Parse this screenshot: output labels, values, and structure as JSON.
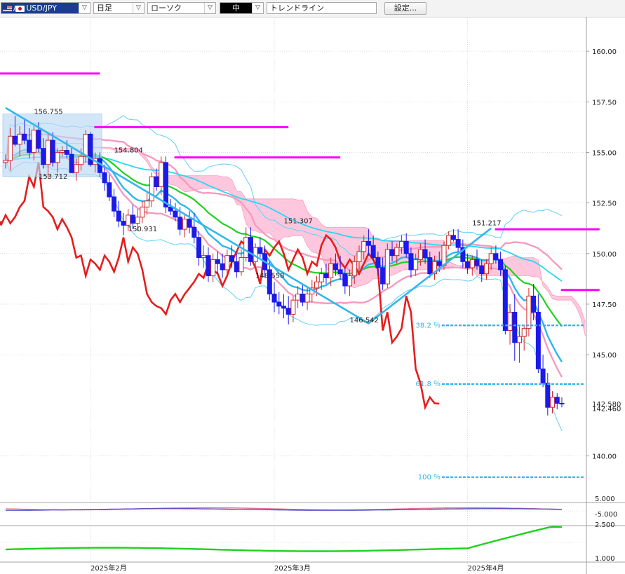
{
  "toolbar": {
    "currency_pair": "USD/JPY",
    "timeframe": "日足",
    "chart_style": "ローソク",
    "size": "中",
    "tool": "トレンドライン",
    "settings_button": "設定..."
  },
  "chart_data": [
    {
      "type": "line",
      "panel": "main",
      "ylim": [
        137.8,
        161.7
      ],
      "y_ticks": [
        "160.00",
        "157.50",
        "155.00",
        "152.50",
        "150.00",
        "147.50",
        "145.00",
        "140.00"
      ],
      "current_price_labels": [
        "142.580",
        "142.460"
      ],
      "x_ticks": [
        "2025年2月",
        "2025年3月",
        "2025年4月"
      ],
      "annotations": [
        {
          "text": "156.755",
          "x": 6,
          "y": 156.8
        },
        {
          "text": "153.712",
          "x": 7,
          "y": 153.6
        },
        {
          "text": "154.804",
          "x": 23,
          "y": 154.9
        },
        {
          "text": "150.931",
          "x": 26,
          "y": 151.0
        },
        {
          "text": "151.307",
          "x": 59,
          "y": 151.4
        },
        {
          "text": "148.558",
          "x": 53,
          "y": 148.7
        },
        {
          "text": "146.542",
          "x": 73,
          "y": 146.5
        },
        {
          "text": "151.217",
          "x": 99,
          "y": 151.3
        }
      ],
      "fibonacci": [
        {
          "label": "38.2 ％",
          "value": 146.45
        },
        {
          "label": "61.8 ％",
          "value": 143.55
        },
        {
          "label": "100 ％",
          "value": 138.95
        }
      ],
      "resistance_lines": [
        {
          "x0": 0,
          "x1": 20,
          "value": 158.9
        },
        {
          "x0": 20,
          "x1": 60,
          "value": 156.25
        },
        {
          "x0": 37,
          "x1": 71,
          "value": 154.75
        },
        {
          "x0": 105,
          "x1": 126,
          "value": 151.2
        },
        {
          "x0": 119,
          "x1": 126,
          "value": 148.2
        }
      ],
      "trendlines": [
        {
          "points": [
            [
              0,
              157.2
            ],
            [
              77,
              146.55
            ],
            [
              103,
              151.25
            ]
          ]
        }
      ],
      "candles": [
        [
          0,
          154.5,
          154.9,
          154.2,
          154.6
        ],
        [
          1,
          154.6,
          156.2,
          154.1,
          155.8
        ],
        [
          2,
          155.8,
          156.8,
          155.3,
          155.4
        ],
        [
          3,
          155.4,
          156.3,
          154.8,
          155.9
        ],
        [
          4,
          155.9,
          156.7,
          155.4,
          155.6
        ],
        [
          5,
          155.6,
          156.2,
          154.7,
          155.0
        ],
        [
          6,
          155.0,
          156.3,
          154.6,
          156.1
        ],
        [
          7,
          156.1,
          156.5,
          155.0,
          155.2
        ],
        [
          8,
          155.2,
          155.7,
          154.2,
          154.4
        ],
        [
          9,
          154.4,
          156.0,
          153.7,
          155.6
        ],
        [
          10,
          155.6,
          156.0,
          154.3,
          154.5
        ],
        [
          11,
          154.5,
          155.2,
          154.0,
          155.0
        ],
        [
          12,
          155.0,
          155.3,
          154.8,
          155.1
        ],
        [
          13,
          155.1,
          155.6,
          154.7,
          154.9
        ],
        [
          14,
          154.9,
          155.3,
          154.0,
          154.0
        ],
        [
          15,
          154.0,
          154.7,
          153.6,
          154.4
        ],
        [
          16,
          154.4,
          155.2,
          154.1,
          154.8
        ],
        [
          17,
          154.8,
          156.1,
          154.5,
          155.9
        ],
        [
          18,
          155.9,
          156.0,
          154.3,
          154.4
        ],
        [
          19,
          154.4,
          155.0,
          154.0,
          154.7
        ],
        [
          20,
          154.7,
          155.0,
          153.8,
          154.0
        ],
        [
          21,
          154.0,
          154.4,
          153.1,
          153.5
        ],
        [
          22,
          153.5,
          153.9,
          152.6,
          152.8
        ],
        [
          23,
          152.8,
          153.2,
          151.8,
          152.1
        ],
        [
          24,
          152.1,
          152.6,
          151.3,
          151.6
        ],
        [
          25,
          151.6,
          152.0,
          150.9,
          151.4
        ],
        [
          26,
          151.4,
          152.2,
          151.1,
          151.9
        ],
        [
          27,
          151.9,
          152.4,
          151.2,
          151.5
        ],
        [
          28,
          151.5,
          152.2,
          151.1,
          151.8
        ],
        [
          29,
          151.8,
          152.6,
          151.5,
          152.3
        ],
        [
          30,
          152.3,
          153.0,
          151.9,
          152.6
        ],
        [
          31,
          152.6,
          154.0,
          152.3,
          153.8
        ],
        [
          32,
          153.8,
          154.2,
          153.1,
          153.3
        ],
        [
          33,
          153.3,
          154.8,
          152.9,
          154.5
        ],
        [
          34,
          154.5,
          154.8,
          152.0,
          152.3
        ],
        [
          35,
          152.3,
          152.7,
          151.9,
          152.1
        ],
        [
          36,
          152.1,
          152.5,
          151.6,
          151.8
        ],
        [
          37,
          151.8,
          152.3,
          150.9,
          151.2
        ],
        [
          38,
          151.2,
          151.9,
          150.8,
          151.7
        ],
        [
          39,
          151.7,
          152.1,
          151.0,
          151.3
        ],
        [
          40,
          151.3,
          152.0,
          150.5,
          150.8
        ],
        [
          41,
          150.8,
          151.1,
          149.4,
          149.8
        ],
        [
          42,
          149.8,
          150.4,
          149.3,
          149.9
        ],
        [
          43,
          149.9,
          150.3,
          148.6,
          148.9
        ],
        [
          44,
          148.9,
          150.0,
          148.6,
          149.7
        ],
        [
          45,
          149.7,
          150.1,
          149.0,
          149.5
        ],
        [
          46,
          149.5,
          150.0,
          148.8,
          149.2
        ],
        [
          47,
          149.2,
          150.2,
          148.9,
          149.9
        ],
        [
          48,
          149.9,
          150.4,
          149.3,
          149.6
        ],
        [
          49,
          149.6,
          150.0,
          148.8,
          149.1
        ],
        [
          50,
          149.1,
          150.2,
          148.9,
          149.8
        ],
        [
          51,
          149.8,
          151.3,
          149.6,
          150.8
        ],
        [
          52,
          150.8,
          151.3,
          149.4,
          149.6
        ],
        [
          53,
          149.6,
          150.5,
          149.3,
          150.3
        ],
        [
          54,
          150.3,
          150.8,
          149.8,
          150.0
        ],
        [
          55,
          150.0,
          150.4,
          148.8,
          149.2
        ],
        [
          56,
          149.2,
          149.6,
          147.7,
          148.0
        ],
        [
          57,
          148.0,
          148.6,
          147.1,
          147.6
        ],
        [
          58,
          147.6,
          148.1,
          147.0,
          147.4
        ],
        [
          59,
          147.4,
          148.0,
          146.8,
          147.3
        ],
        [
          60,
          147.3,
          147.9,
          146.5,
          147.0
        ],
        [
          61,
          147.0,
          147.9,
          146.6,
          147.7
        ],
        [
          62,
          147.7,
          148.4,
          147.3,
          148.0
        ],
        [
          63,
          148.0,
          148.5,
          147.4,
          147.6
        ],
        [
          64,
          147.6,
          148.3,
          147.2,
          148.0
        ],
        [
          65,
          148.0,
          148.7,
          147.6,
          148.3
        ],
        [
          66,
          148.3,
          148.9,
          147.9,
          148.6
        ],
        [
          67,
          148.6,
          149.3,
          148.2,
          149.0
        ],
        [
          68,
          149.0,
          149.5,
          148.5,
          148.8
        ],
        [
          69,
          148.8,
          149.8,
          148.4,
          149.5
        ],
        [
          70,
          149.5,
          150.0,
          148.9,
          149.2
        ],
        [
          71,
          149.2,
          149.9,
          148.7,
          149.0
        ],
        [
          72,
          149.0,
          149.3,
          148.0,
          148.4
        ],
        [
          73,
          148.4,
          149.2,
          147.9,
          148.9
        ],
        [
          74,
          148.9,
          149.9,
          148.5,
          149.6
        ],
        [
          75,
          149.6,
          150.4,
          149.2,
          150.1
        ],
        [
          76,
          150.1,
          150.9,
          149.7,
          150.6
        ],
        [
          77,
          150.6,
          151.2,
          149.9,
          150.4
        ],
        [
          78,
          150.4,
          150.9,
          149.6,
          149.8
        ],
        [
          79,
          149.8,
          150.1,
          148.9,
          149.3
        ],
        [
          80,
          149.3,
          149.8,
          148.2,
          148.5
        ],
        [
          81,
          148.5,
          150.5,
          148.3,
          150.2
        ],
        [
          82,
          150.2,
          150.6,
          149.6,
          149.9
        ],
        [
          83,
          149.9,
          150.5,
          149.5,
          150.3
        ],
        [
          84,
          150.3,
          150.9,
          150.0,
          150.6
        ],
        [
          85,
          150.6,
          151.0,
          149.8,
          150.0
        ],
        [
          86,
          150.0,
          150.3,
          148.8,
          149.2
        ],
        [
          87,
          149.2,
          150.0,
          148.9,
          149.7
        ],
        [
          88,
          149.7,
          150.5,
          149.4,
          150.2
        ],
        [
          89,
          150.2,
          150.7,
          149.5,
          149.8
        ],
        [
          90,
          149.8,
          150.1,
          148.8,
          149.0
        ],
        [
          91,
          149.0,
          149.9,
          148.7,
          149.6
        ],
        [
          92,
          149.6,
          150.1,
          149.1,
          149.4
        ],
        [
          93,
          149.4,
          150.6,
          149.2,
          150.4
        ],
        [
          94,
          150.4,
          151.1,
          150.2,
          150.9
        ],
        [
          95,
          150.9,
          151.2,
          150.6,
          150.7
        ],
        [
          96,
          150.7,
          151.2,
          150.1,
          150.3
        ],
        [
          97,
          150.3,
          150.7,
          149.3,
          149.6
        ],
        [
          98,
          149.6,
          150.0,
          149.0,
          149.3
        ],
        [
          99,
          149.3,
          149.9,
          148.9,
          149.7
        ],
        [
          100,
          149.7,
          150.2,
          149.2,
          149.4
        ],
        [
          101,
          149.4,
          149.7,
          148.6,
          149.0
        ],
        [
          102,
          149.0,
          149.7,
          148.7,
          149.5
        ],
        [
          103,
          149.5,
          150.3,
          149.2,
          150.0
        ],
        [
          104,
          150.0,
          150.4,
          149.5,
          149.7
        ],
        [
          105,
          149.7,
          150.1,
          148.9,
          149.2
        ],
        [
          106,
          149.2,
          149.4,
          146.0,
          146.2
        ],
        [
          107,
          146.2,
          147.5,
          145.5,
          147.1
        ],
        [
          108,
          147.1,
          148.0,
          144.7,
          145.6
        ],
        [
          109,
          145.6,
          146.4,
          144.6,
          145.9
        ],
        [
          110,
          145.9,
          146.4,
          145.2,
          146.3
        ],
        [
          111,
          146.3,
          148.3,
          145.9,
          147.9
        ],
        [
          112,
          147.9,
          148.5,
          146.7,
          147.1
        ],
        [
          113,
          147.1,
          148.0,
          144.1,
          144.3
        ],
        [
          114,
          144.3,
          145.0,
          143.4,
          143.6
        ],
        [
          115,
          143.6,
          144.1,
          142.0,
          142.4
        ],
        [
          116,
          142.4,
          143.2,
          142.1,
          142.9
        ],
        [
          117,
          142.9,
          143.1,
          142.3,
          142.6
        ],
        [
          118,
          142.6,
          142.9,
          142.4,
          142.58
        ]
      ]
    },
    {
      "type": "line",
      "panel": "sub1",
      "y_ticks": [
        "5.000",
        "-5.000"
      ]
    },
    {
      "type": "line",
      "panel": "sub2",
      "y_ticks": [
        "2.500",
        "1.000"
      ]
    }
  ],
  "colors": {
    "bull": "#d22828",
    "bear": "#1a1aeb",
    "cloud": "#ffb4d2",
    "kumo_box": "#bcd8f5",
    "resistance": "#ff00ff",
    "trendline": "#33b6ee",
    "fib": "#27b3ee"
  }
}
